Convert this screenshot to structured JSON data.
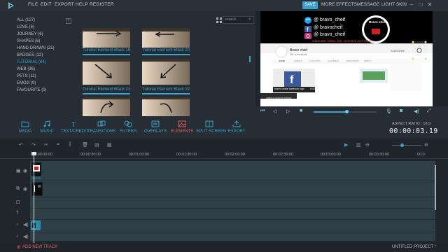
{
  "menu": {
    "items": [
      "FILE",
      "EDIT",
      "EXPORT",
      "HELP",
      "REGISTER"
    ],
    "save": "SAVE",
    "more_effects": "MORE EFFECTS",
    "message": "MESSAGE",
    "light_skin": "LIGHT SKIN"
  },
  "library": {
    "categories": [
      {
        "label": "ALL (127)",
        "active": false
      },
      {
        "label": "LOVE (6)",
        "active": false
      },
      {
        "label": "JOURNEY (6)",
        "active": false
      },
      {
        "label": "SHAPES (6)",
        "active": false
      },
      {
        "label": "HAND DRAWN (21)",
        "active": false
      },
      {
        "label": "BADGES (12)",
        "active": false
      },
      {
        "label": "TUTORIAL (64)",
        "active": true
      },
      {
        "label": "WEB (36)",
        "active": false
      },
      {
        "label": "PETS (11)",
        "active": false
      },
      {
        "label": "EMOJI (9)",
        "active": false
      },
      {
        "label": "FAVOURITE (0)",
        "active": false
      }
    ],
    "add_label": "+",
    "search_placeholder": "search",
    "thumbnails": [
      {
        "label": "Tutorial Element Black 19"
      },
      {
        "label": "Tutorial Element Black 20"
      },
      {
        "label": "Tutorial Element Black 21"
      },
      {
        "label": "Tutorial Element Black 22"
      },
      {
        "label": ""
      },
      {
        "label": ""
      }
    ]
  },
  "preview": {
    "social": [
      {
        "handle": "@ bravo_cheif",
        "icon": "twitter-icon",
        "color": "#1da1f2"
      },
      {
        "handle": "@ bravocheif",
        "icon": "facebook-icon",
        "color": "#3b5998"
      },
      {
        "handle": "@ bravo_cheif",
        "icon": "instagram-icon",
        "color": "#c13584"
      }
    ],
    "badge_text": "Bravo chief",
    "cta": "subscribe, follow, like, comment and share",
    "channel_name": "Bravo chief",
    "channel_subs": "361 subscribers",
    "tabs": [
      "HOME",
      "VIDEOS",
      "PLAYLISTS",
      "CHANNELS",
      "DISCUSSION",
      "ABOUT"
    ],
    "video_title": "how to make facebook logo",
    "video_time": "5:32",
    "tooltip": "make a custom window",
    "subscribe": "SUBSCRIBE"
  },
  "toolbar": {
    "tools": [
      {
        "label": "MEDIA",
        "icon": "folder-icon"
      },
      {
        "label": "MUSIC",
        "icon": "music-icon"
      },
      {
        "label": "TEXT/CREDIT",
        "icon": "text-icon"
      },
      {
        "label": "TRANSITIONS",
        "icon": "transition-icon"
      },
      {
        "label": "FILTERS",
        "icon": "filter-icon"
      },
      {
        "label": "OVERLAYS",
        "icon": "overlay-icon"
      },
      {
        "label": "ELEMENTS",
        "icon": "elements-icon"
      },
      {
        "label": "SPLIT SCREEN",
        "icon": "split-screen-icon"
      },
      {
        "label": "EXPORT",
        "icon": "export-icon"
      }
    ],
    "aspect_ratio": "ASPECT RATIO : 16:9",
    "timecode": "00:00:03.19"
  },
  "timeline": {
    "ruler": [
      "00:00:00:00",
      "00:00:30:00",
      "00:01:00:00",
      "00:01:30:00",
      "00:02:00:00",
      "00:02:30:00",
      "00:03:00:00",
      "00:03:30:00",
      "00:0"
    ],
    "add_track": "ADD NEW TRACK",
    "project": "UNTITLED PROJECT *"
  },
  "colors": {
    "accent": "#3ba1c9",
    "active": "#e05d5d",
    "bg": "#1f252b",
    "panel": "#262d34"
  }
}
